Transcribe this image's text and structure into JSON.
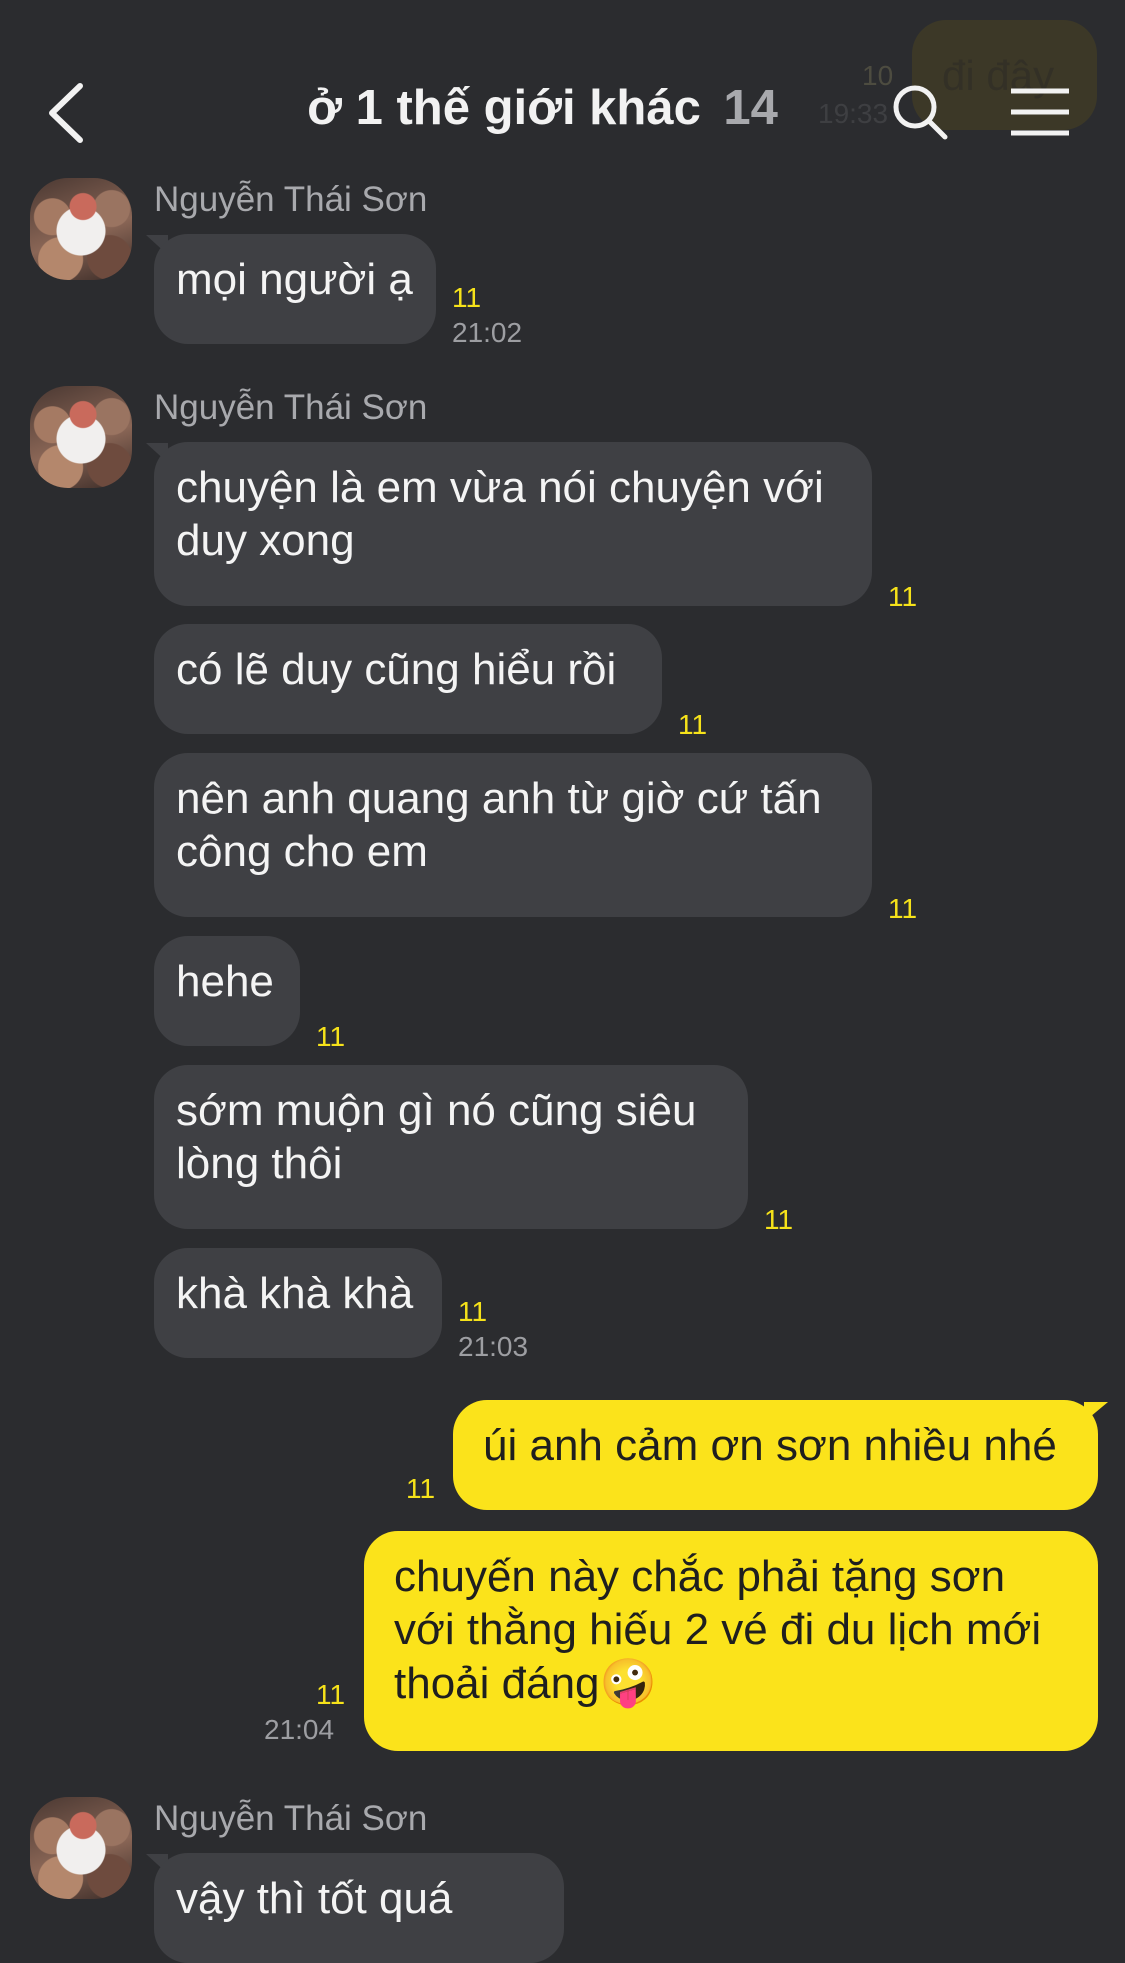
{
  "header": {
    "title": "ở 1 thế giới khác",
    "member_count": "14",
    "peek_message": "đi đây",
    "peek_unread": "10",
    "peek_time": "19:33"
  },
  "messages": [
    {
      "sender": "Nguyễn Thái Sơn",
      "text": "mọi người ạ",
      "unread": "11",
      "time": "21:02"
    },
    {
      "sender": "Nguyễn Thái Sơn",
      "text": "chuyện là em vừa nói chuyện với duy xong",
      "unread": "11"
    },
    {
      "text": "có lẽ duy cũng hiểu rồi",
      "unread": "11"
    },
    {
      "text": "nên anh quang anh từ giờ cứ tấn công cho em",
      "unread": "11"
    },
    {
      "text": "hehe",
      "unread": "11"
    },
    {
      "text": "sớm muộn gì nó cũng siêu lòng thôi",
      "unread": "11"
    },
    {
      "text": "khà khà khà",
      "unread": "11",
      "time": "21:03"
    },
    {
      "text": "úi anh cảm ơn sơn nhiều nhé",
      "unread": "11"
    },
    {
      "text": "chuyến này chắc phải tặng sơn với thằng hiếu 2 vé đi du lịch mới thoải đáng",
      "unread": "11",
      "time": "21:04",
      "emoji": "🤪"
    },
    {
      "sender": "Nguyễn Thái Sơn",
      "text": "vậy thì tốt quá"
    }
  ],
  "icons": [
    "back-arrow-icon",
    "search-icon",
    "menu-icon",
    "emoji-icon"
  ],
  "colors": {
    "background": "#2b2c2f",
    "incoming_bubble": "#3f4044",
    "outgoing_bubble": "#fbe31b",
    "unread_count": "#f6e21a"
  }
}
